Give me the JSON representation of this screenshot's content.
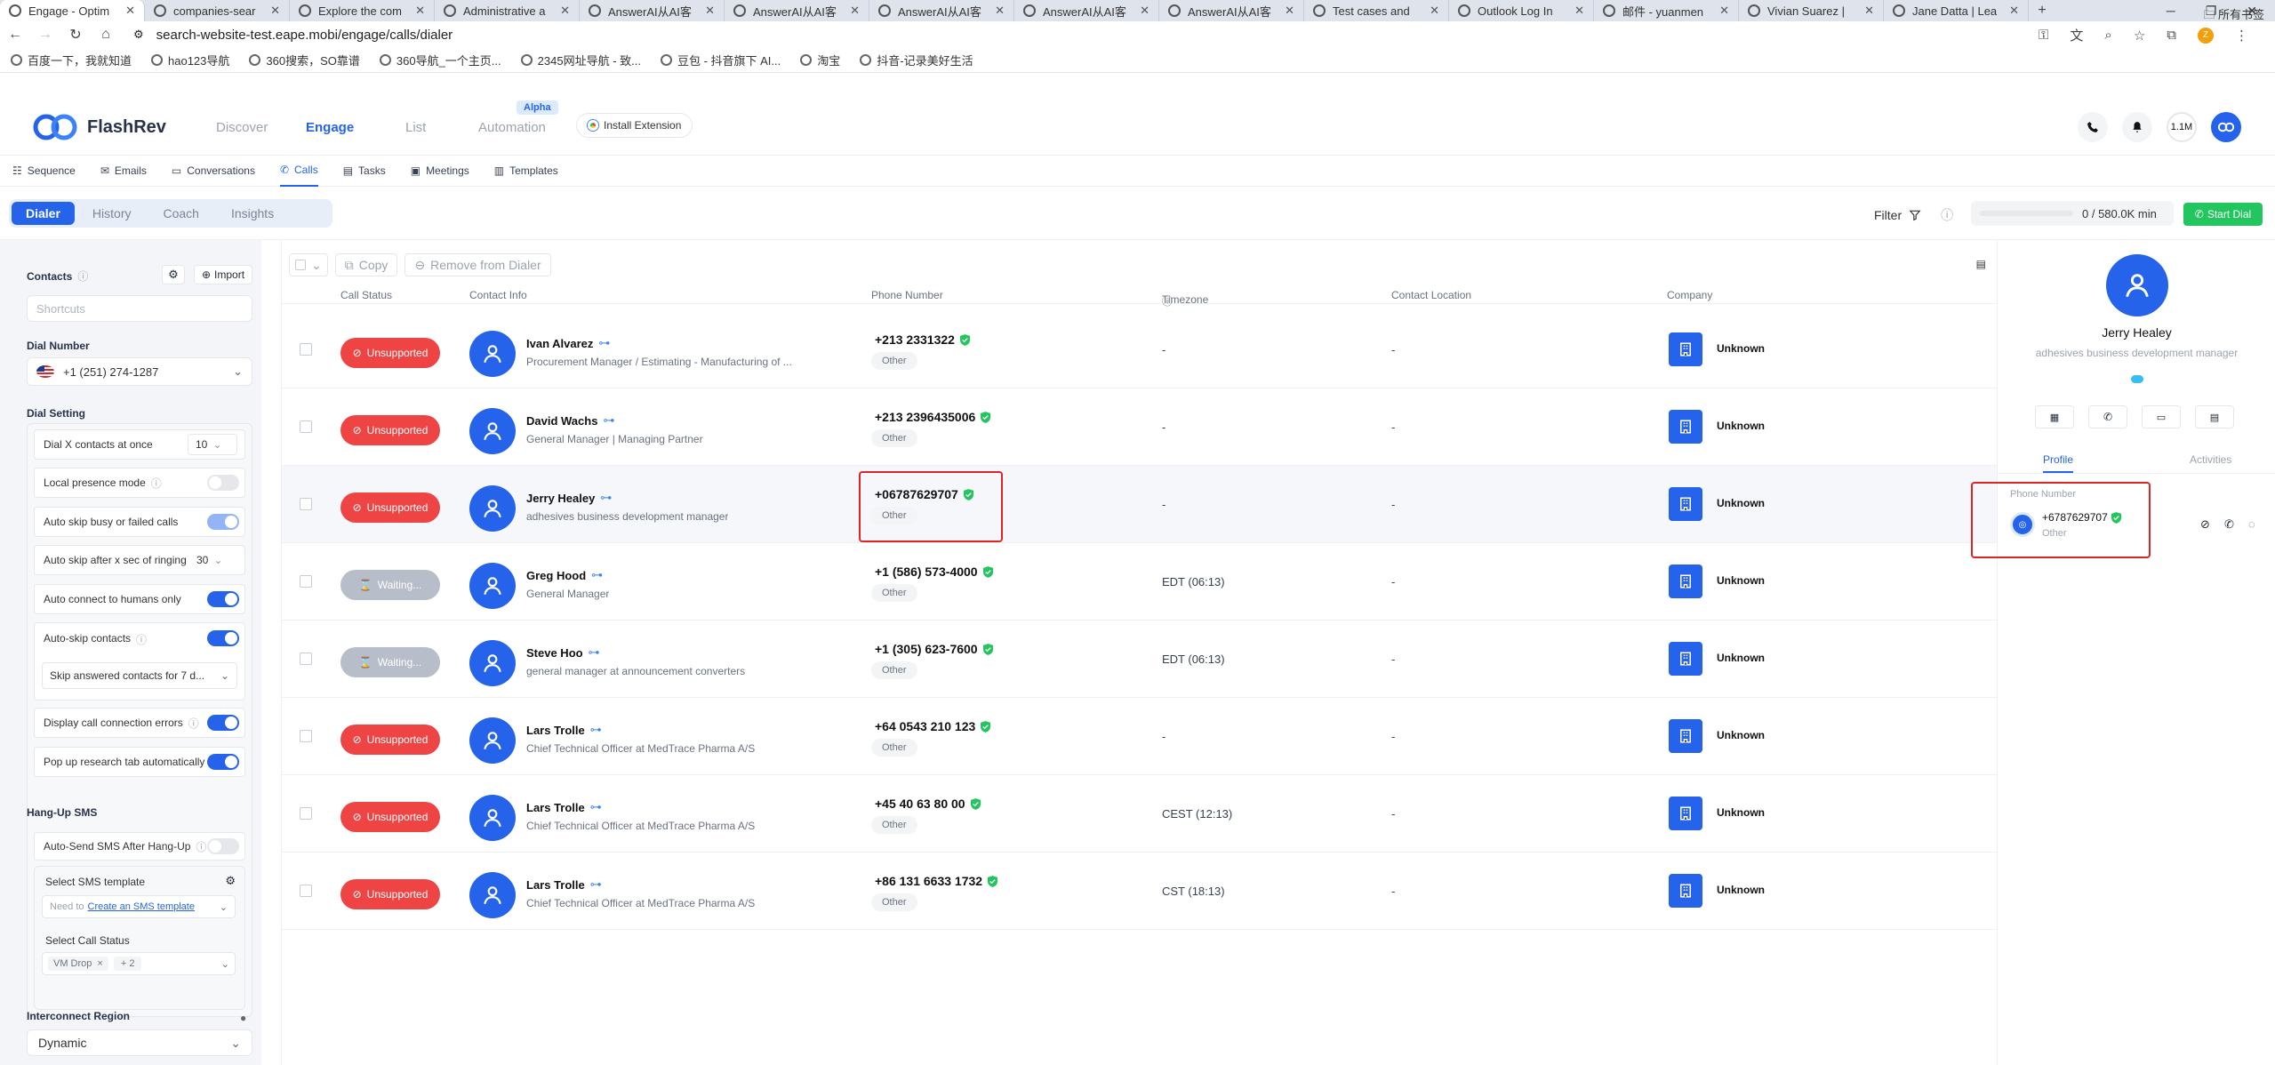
{
  "browser": {
    "tabs": [
      {
        "title": "Engage - Optim",
        "active": true
      },
      {
        "title": "companies-sear",
        "active": false
      },
      {
        "title": "Explore the com",
        "active": false
      },
      {
        "title": "Administrative a",
        "active": false
      },
      {
        "title": "AnswerAI从AI客",
        "active": false
      },
      {
        "title": "AnswerAI从AI客",
        "active": false
      },
      {
        "title": "AnswerAI从AI客",
        "active": false
      },
      {
        "title": "AnswerAI从AI客",
        "active": false
      },
      {
        "title": "AnswerAI从AI客",
        "active": false
      },
      {
        "title": "Test cases and",
        "active": false
      },
      {
        "title": "Outlook Log In",
        "active": false
      },
      {
        "title": "邮件 - yuanmen",
        "active": false
      },
      {
        "title": "Vivian Suarez |",
        "active": false
      },
      {
        "title": "Jane Datta | Lea",
        "active": false
      }
    ],
    "url": "search-website-test.eape.mobi/engage/calls/dialer",
    "profile_initial": "Z",
    "bookmarks": [
      "百度一下，我就知道",
      "hao123导航",
      "360搜索，SO靠谱",
      "360导航_一个主页...",
      "2345网址导航 - 致...",
      "豆包 - 抖音旗下 AI...",
      "淘宝",
      "抖音-记录美好生活"
    ],
    "all_bookmarks": "所有书签"
  },
  "app": {
    "brand": "FlashRev",
    "nav": [
      "Discover",
      "Engage",
      "List",
      "Automation"
    ],
    "active_nav": "Engage",
    "alpha_badge": "Alpha",
    "install_extension": "Install Extension",
    "credits": "1.1M",
    "subnav": [
      "Sequence",
      "Emails",
      "Conversations",
      "Calls",
      "Tasks",
      "Meetings",
      "Templates"
    ],
    "modes": [
      "Dialer",
      "History",
      "Coach",
      "Insights"
    ],
    "filter_label": "Filter",
    "minutes": "0 / 580.0K min",
    "start_dial": "Start Dial"
  },
  "sidebar": {
    "contacts_label": "Contacts",
    "import_label": "Import",
    "shortcuts_placeholder": "Shortcuts",
    "dial_number_label": "Dial Number",
    "dial_number": "+1 (251) 274-1287",
    "dial_setting_label": "Dial Setting",
    "settings": {
      "dial_x": "Dial X contacts at once",
      "dial_x_value": "10",
      "local_presence": "Local presence mode",
      "auto_skip_busy": "Auto skip busy or failed calls",
      "auto_skip_ringing": "Auto skip after x sec of ringing",
      "auto_skip_ringing_value": "30",
      "auto_connect": "Auto connect to humans only",
      "auto_skip_contacts": "Auto-skip contacts",
      "skip_answered": "Skip answered contacts for 7 d...",
      "display_errors": "Display call connection errors",
      "popup_research": "Pop up research tab automatically"
    },
    "hangup_label": "Hang-Up SMS",
    "auto_send_sms": "Auto-Send SMS After Hang-Up",
    "select_sms_template": "Select SMS template",
    "need_to": "Need to",
    "create_sms_template": "Create an SMS template",
    "select_call_status": "Select Call Status",
    "call_status_tag": "VM Drop",
    "call_status_more": "+ 2",
    "interconnect_label": "Interconnect Region",
    "interconnect_value": "Dynamic"
  },
  "table": {
    "copy_label": "Copy",
    "remove_label": "Remove from Dialer",
    "columns": [
      "Call Status",
      "Contact Info",
      "Phone Number",
      "Timezone",
      "Contact Location",
      "Company"
    ],
    "rows": [
      {
        "status": "Unsupported",
        "name": "Ivan Alvarez",
        "title": "Procurement Manager / Estimating - Manufacturing of ...",
        "phone": "+213 2331322",
        "phone_type": "Other",
        "timezone": "-",
        "location": "-",
        "company": "Unknown"
      },
      {
        "status": "Unsupported",
        "name": "David Wachs",
        "title": "General Manager | Managing Partner",
        "phone": "+213 2396435006",
        "phone_type": "Other",
        "timezone": "-",
        "location": "-",
        "company": "Unknown"
      },
      {
        "status": "Unsupported",
        "name": "Jerry Healey",
        "title": "adhesives business development manager",
        "phone": "+06787629707",
        "phone_type": "Other",
        "timezone": "-",
        "location": "-",
        "company": "Unknown"
      },
      {
        "status": "Waiting...",
        "name": "Greg Hood",
        "title": "General Manager",
        "phone": "+1 (586) 573-4000",
        "phone_type": "Other",
        "timezone": "EDT (06:13)",
        "location": "-",
        "company": "Unknown"
      },
      {
        "status": "Waiting...",
        "name": "Steve Hoo",
        "title": "general manager at announcement converters",
        "phone": "+1 (305) 623-7600",
        "phone_type": "Other",
        "timezone": "EDT (06:13)",
        "location": "-",
        "company": "Unknown"
      },
      {
        "status": "Unsupported",
        "name": "Lars Trolle",
        "title": "Chief Technical Officer at MedTrace Pharma A/S",
        "phone": "+64 0543 210 123",
        "phone_type": "Other",
        "timezone": "-",
        "location": "-",
        "company": "Unknown"
      },
      {
        "status": "Unsupported",
        "name": "Lars Trolle",
        "title": "Chief Technical Officer at MedTrace Pharma A/S",
        "phone": "+45 40 63 80 00",
        "phone_type": "Other",
        "timezone": "CEST (12:13)",
        "location": "-",
        "company": "Unknown"
      },
      {
        "status": "Unsupported",
        "name": "Lars Trolle",
        "title": "Chief Technical Officer at MedTrace Pharma A/S",
        "phone": "+86 131 6633 1732",
        "phone_type": "Other",
        "timezone": "CST (18:13)",
        "location": "-",
        "company": "Unknown"
      }
    ]
  },
  "panel": {
    "name": "Jerry Healey",
    "title": "adhesives business development manager",
    "tabs": [
      "Profile",
      "Activities"
    ],
    "phone_label": "Phone Number",
    "phone": "+6787629707",
    "phone_type": "Other"
  },
  "colors": {
    "accent": "#2563eb",
    "danger": "#ef4444",
    "success": "#22c55e",
    "waiting": "#b7bdc9",
    "highlight": "#dc2626"
  }
}
